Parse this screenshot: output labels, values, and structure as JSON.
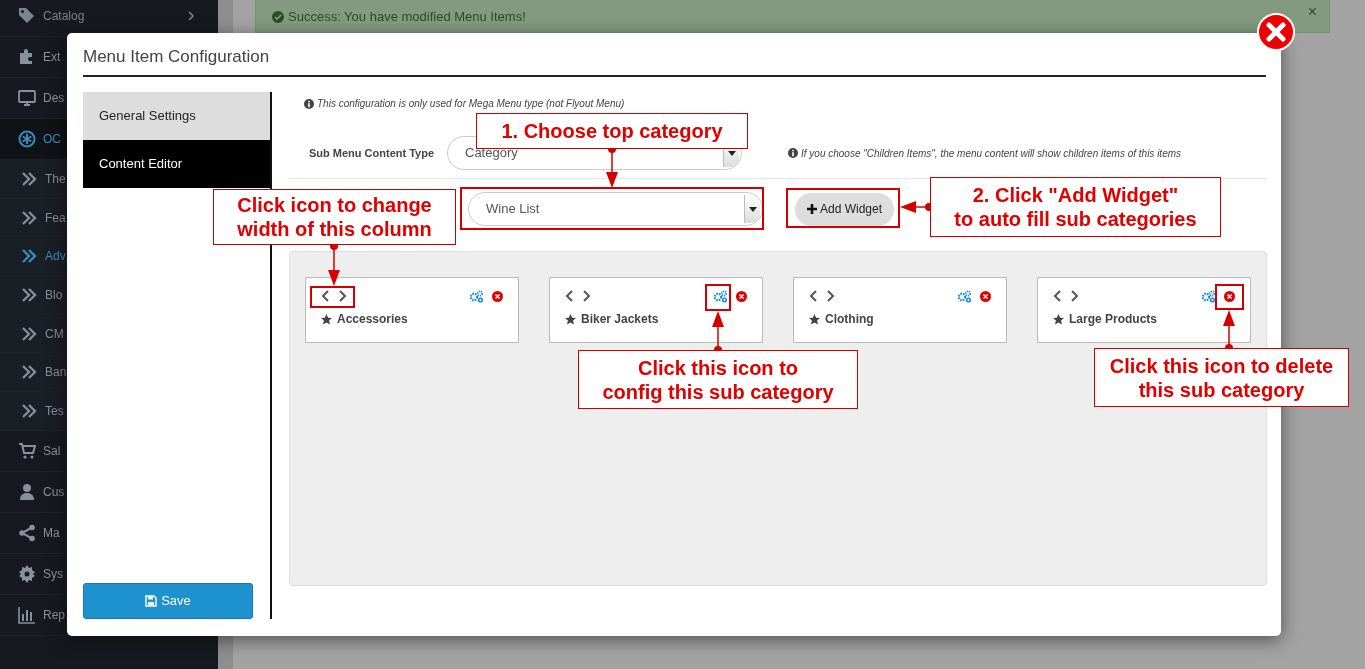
{
  "sidebar": {
    "items": [
      {
        "kind": "menu",
        "label": "Catalog",
        "selected": false
      },
      {
        "kind": "menu",
        "label": "Ext",
        "selected": false
      },
      {
        "kind": "menu",
        "label": "Des",
        "selected": false
      },
      {
        "kind": "menu",
        "label": "OC",
        "selected": true
      },
      {
        "kind": "sub",
        "label": "The",
        "selected": false
      },
      {
        "kind": "sub",
        "label": "Fea",
        "selected": false
      },
      {
        "kind": "sub",
        "label": "Adv",
        "selected": true
      },
      {
        "kind": "sub",
        "label": "Blo",
        "selected": false
      },
      {
        "kind": "sub",
        "label": "CM",
        "selected": false
      },
      {
        "kind": "sub",
        "label": "Ban",
        "selected": false
      },
      {
        "kind": "sub",
        "label": "Tes",
        "selected": false
      },
      {
        "kind": "menu",
        "label": "Sal",
        "selected": false
      },
      {
        "kind": "menu",
        "label": "Cus",
        "selected": false
      },
      {
        "kind": "menu",
        "label": "Ma",
        "selected": false
      },
      {
        "kind": "menu",
        "label": "Sys",
        "selected": false
      },
      {
        "kind": "menu",
        "label": "Rep",
        "selected": false
      }
    ]
  },
  "alert": {
    "text": "Success: You have modified Menu Items!",
    "close": "×"
  },
  "modal": {
    "title": "Menu Item Configuration",
    "tabs": [
      {
        "label": "General Settings",
        "selected": false
      },
      {
        "label": "Content Editor",
        "selected": true
      }
    ],
    "save_button": "Save",
    "note": "This configuration is only used for Mega Menu type (not Flyout Menu)",
    "content_type": {
      "label": "Sub Menu Content Type",
      "value": "Category",
      "hint": "If you choose \"Children Items\", the menu content will show children items of this items"
    },
    "category_select": {
      "value": "Wine List"
    },
    "add_widget_button": "Add Widget",
    "widgets": [
      {
        "title": "Accessories"
      },
      {
        "title": "Biker Jackets"
      },
      {
        "title": "Clothing"
      },
      {
        "title": "Large Products"
      }
    ]
  },
  "annotations": [
    {
      "text": "1. Choose top category"
    },
    {
      "text": "Click icon to change\nwidth of this column"
    },
    {
      "text": "2. Click \"Add Widget\"\nto auto fill sub categories"
    },
    {
      "text": "Click this icon to\nconfig this sub category"
    },
    {
      "text": "Click this icon to delete\nthis sub category"
    }
  ]
}
